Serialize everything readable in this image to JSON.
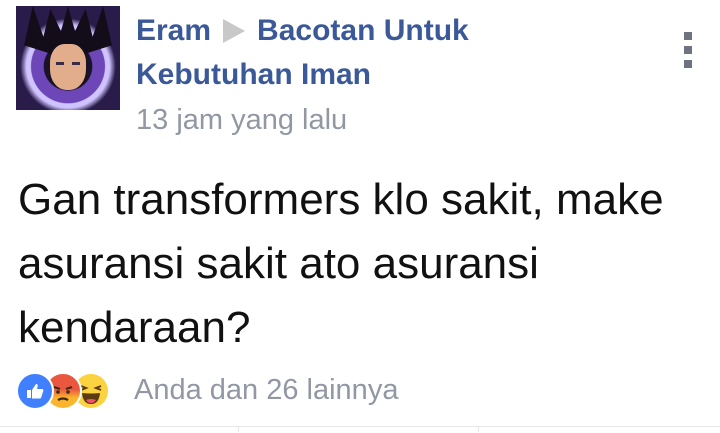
{
  "post": {
    "author": "Eram",
    "group_line1": "Bacotan Untuk",
    "group_line2": "Kebutuhan Iman",
    "timestamp": "13 jam yang lalu",
    "body": "Gan transformers klo sakit, make asuransi sakit ato asuransi kendaraan?"
  },
  "reactions": {
    "icons": [
      "like-icon",
      "angry-icon",
      "haha-icon"
    ],
    "summary": "Anda dan 26 lainnya",
    "colors": {
      "like": "#4080ff",
      "angry": "#e9573f",
      "haha": "#fbd23f"
    }
  },
  "theme": {
    "link_color": "#3b5998",
    "meta_color": "#9197a3"
  },
  "icons": {
    "more": "vertical-dots-icon",
    "separator": "triangle-arrow-icon"
  }
}
